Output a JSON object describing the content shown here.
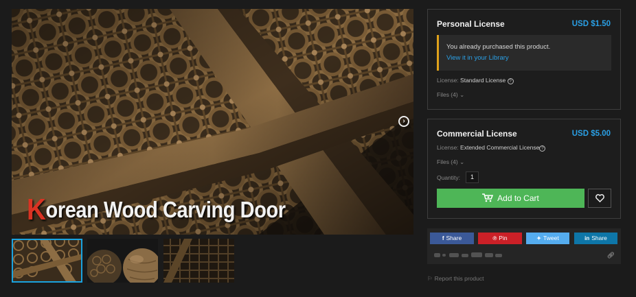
{
  "product": {
    "image_title": "Korean Wood Carving Door",
    "image_title_first": "K",
    "image_title_rest": "orean Wood Carving Door"
  },
  "gallery": {
    "thumbnails": [
      "thumbnail-door",
      "thumbnail-spheres",
      "thumbnail-closeup"
    ],
    "active_index": 0
  },
  "personal_license": {
    "title": "Personal License",
    "price": "USD $1.50",
    "notice_text": "You already purchased this product.",
    "notice_link": "View it in your Library",
    "license_label": "License:",
    "license_value": "Standard License",
    "files": "Files (4)"
  },
  "commercial_license": {
    "title": "Commercial License",
    "price": "USD $5.00",
    "license_label": "License:",
    "license_value": "Extended Commercial License",
    "files": "Files (4)",
    "quantity_label": "Quantity:",
    "quantity_value": "1",
    "add_to_cart": "Add to Cart"
  },
  "share": {
    "facebook": "Share",
    "pinterest": "Pin",
    "twitter": "Tweet",
    "linkedin": "Share"
  },
  "report": "Report this product",
  "colors": {
    "accent_blue": "#2aa0e6",
    "cart_green": "#4eb657",
    "notice_border": "#e0a21a",
    "facebook": "#3b5998",
    "pinterest": "#cb2027",
    "twitter": "#55acee",
    "linkedin": "#0e76a8"
  },
  "icons": [
    "next-arrow-icon",
    "help-icon",
    "chevron-down-icon",
    "cart-icon",
    "heart-icon",
    "facebook-icon",
    "pinterest-icon",
    "twitter-icon",
    "linkedin-icon",
    "link-icon",
    "flag-icon"
  ]
}
